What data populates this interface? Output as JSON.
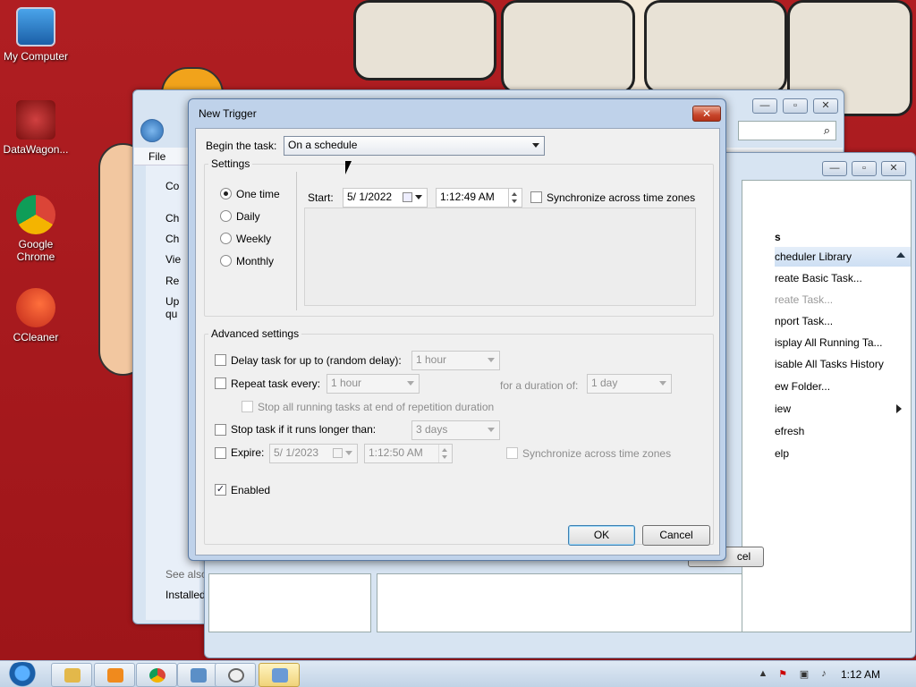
{
  "desktop": {
    "icons": [
      {
        "label": "My Computer"
      },
      {
        "label": "DataWagon..."
      },
      {
        "label": "Google Chrome"
      },
      {
        "label": "CCleaner"
      }
    ]
  },
  "back_window_left": {
    "menu_file": "File",
    "side_labels": [
      "Co",
      "Ch",
      "Ch",
      "Vie",
      "Re",
      "Up",
      "qu"
    ],
    "see_also": "See also",
    "installed": "Installed"
  },
  "back_window_right": {
    "header": "s",
    "section_title": "cheduler Library",
    "actions": [
      "reate Basic Task...",
      "reate Task...",
      "nport Task...",
      "isplay All Running Ta...",
      "isable All Tasks History",
      "ew Folder...",
      "iew",
      "efresh",
      "elp"
    ],
    "cancel_partial": "cel"
  },
  "dialog": {
    "title": "New Trigger",
    "close_glyph": "✕",
    "begin_label": "Begin the task:",
    "begin_value": "On a schedule",
    "settings_title": "Settings",
    "schedule_options": [
      {
        "label": "One time",
        "selected": true
      },
      {
        "label": "Daily",
        "selected": false
      },
      {
        "label": "Weekly",
        "selected": false
      },
      {
        "label": "Monthly",
        "selected": false
      }
    ],
    "start_label": "Start:",
    "start_date": "5/ 1/2022",
    "start_time": "1:12:49 AM",
    "sync_label": "Synchronize across time zones",
    "advanced_title": "Advanced settings",
    "delay_label": "Delay task for up to (random delay):",
    "delay_value": "1 hour",
    "repeat_label": "Repeat task every:",
    "repeat_value": "1 hour",
    "duration_label": "for a duration of:",
    "duration_value": "1 day",
    "stop_all_label": "Stop all running tasks at end of repetition duration",
    "stop_longer_label": "Stop task if it runs longer than:",
    "stop_longer_value": "3 days",
    "expire_label": "Expire:",
    "expire_date": "5/ 1/2023",
    "expire_time": "1:12:50 AM",
    "expire_sync_label": "Synchronize across time zones",
    "enabled_label": "Enabled",
    "enabled_checked": "✓",
    "ok_label": "OK",
    "cancel_label": "Cancel"
  },
  "taskbar": {
    "clock": "1:12 AM"
  }
}
